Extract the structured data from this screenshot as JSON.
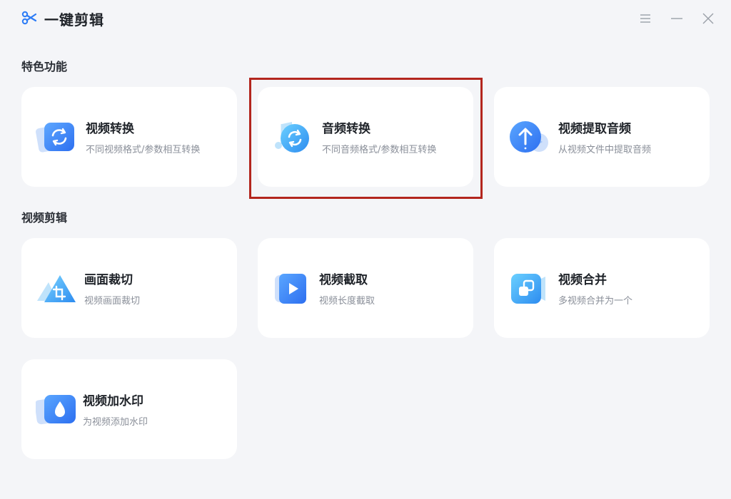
{
  "app": {
    "title": "一键剪辑",
    "logo_icon": "scissors-icon",
    "window_controls": [
      "menu-icon",
      "minimize-icon",
      "close-icon"
    ]
  },
  "sections": {
    "featured": {
      "title": "特色功能",
      "cards": [
        {
          "name": "视频转换",
          "desc": "不同视频格式/参数相互转换",
          "icon": "video-convert-icon"
        },
        {
          "name": "音频转换",
          "desc": "不同音频格式/参数相互转换",
          "icon": "audio-convert-icon",
          "highlighted": true
        },
        {
          "name": "视频提取音频",
          "desc": "从视频文件中提取音频",
          "icon": "extract-audio-icon"
        }
      ]
    },
    "editing": {
      "title": "视频剪辑",
      "cards": [
        {
          "name": "画面裁切",
          "desc": "视频画面裁切",
          "icon": "crop-icon"
        },
        {
          "name": "视频截取",
          "desc": "视频长度截取",
          "icon": "video-trim-icon"
        },
        {
          "name": "视频合并",
          "desc": "多视频合并为一个",
          "icon": "video-merge-icon"
        },
        {
          "name": "视频加水印",
          "desc": "为视频添加水印",
          "icon": "watermark-icon"
        }
      ]
    }
  },
  "colors": {
    "accent": "#2d7cf6",
    "accent_light": "#4fb3f6",
    "background": "#f4f5f8",
    "card": "#ffffff",
    "highlight": "#b3261e"
  }
}
